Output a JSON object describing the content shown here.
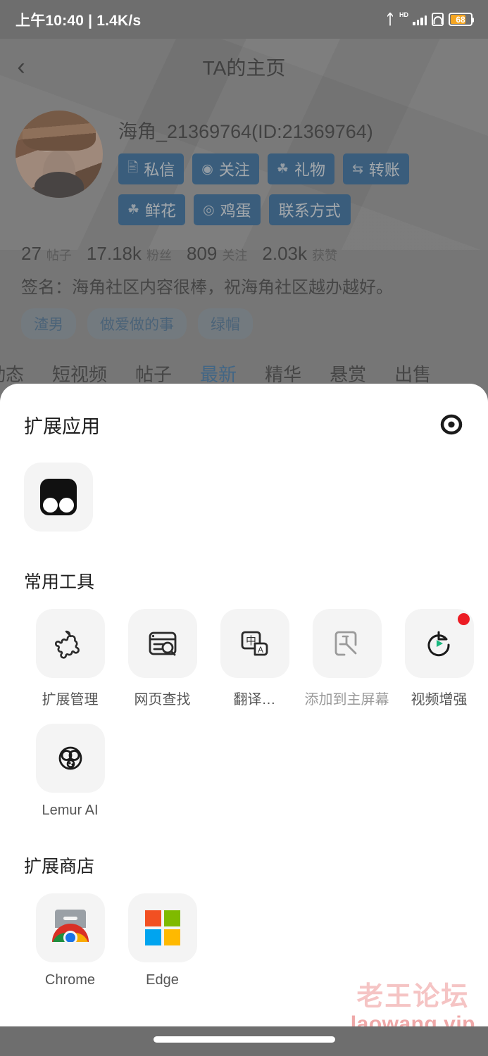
{
  "status_bar": {
    "time_text": "上午10:40 | 1.4K/s",
    "bluetooth_icon": "bluetooth-icon",
    "network_label": "HD",
    "battery_percent": "68"
  },
  "background_app": {
    "back_icon": "chevron-left-icon",
    "title": "TA的主页",
    "profile": {
      "username": "海角_21369764(ID:21369764)",
      "avatar": "user-avatar",
      "action_buttons_row1": [
        {
          "label": "私信",
          "icon": "message-icon"
        },
        {
          "label": "关注",
          "icon": "follow-icon"
        },
        {
          "label": "礼物",
          "icon": "gift-icon"
        },
        {
          "label": "转账",
          "icon": "transfer-icon"
        }
      ],
      "action_buttons_row2": [
        {
          "label": "鲜花",
          "icon": "flower-icon"
        },
        {
          "label": "鸡蛋",
          "icon": "egg-icon"
        },
        {
          "label": "联系方式",
          "icon": ""
        }
      ],
      "stats": [
        {
          "value": "27",
          "label": "帖子"
        },
        {
          "value": "17.18k",
          "label": "粉丝"
        },
        {
          "value": "809",
          "label": "关注"
        },
        {
          "value": "2.03k",
          "label": "获赞"
        }
      ],
      "signature": "签名：海角社区内容很棒，祝海角社区越办越好。",
      "tags": [
        "渣男",
        "做爱做的事",
        "绿帽"
      ]
    },
    "tabs": [
      {
        "label": "动态",
        "active": false
      },
      {
        "label": "短视频",
        "active": false
      },
      {
        "label": "帖子",
        "active": false
      },
      {
        "label": "最新",
        "active": true
      },
      {
        "label": "精华",
        "active": false
      },
      {
        "label": "悬赏",
        "active": false
      },
      {
        "label": "出售",
        "active": false
      }
    ],
    "active_tab_color": "#2f6fa8"
  },
  "sheet": {
    "title": "扩展应用",
    "header_action_icon": "target-record-icon",
    "pinned_extensions": [
      {
        "name": "",
        "icon": "extension-dual-circle-icon"
      }
    ],
    "sections": [
      {
        "title": "常用工具",
        "items": [
          {
            "label": "扩展管理",
            "icon": "puzzle-piece-icon",
            "disabled": false,
            "badge": false
          },
          {
            "label": "网页查找",
            "icon": "page-search-icon",
            "disabled": false,
            "badge": false
          },
          {
            "label": "翻译…",
            "icon": "translate-icon",
            "disabled": false,
            "badge": false
          },
          {
            "label": "添加到主屏幕",
            "icon": "add-to-homescreen-icon",
            "disabled": true,
            "badge": false
          },
          {
            "label": "视频增强",
            "icon": "video-enhance-icon",
            "disabled": false,
            "badge": true
          },
          {
            "label": "Lemur AI",
            "icon": "lemur-face-icon",
            "disabled": false,
            "badge": false
          }
        ]
      },
      {
        "title": "扩展商店",
        "items": [
          {
            "label": "Chrome",
            "icon": "chrome-webstore-icon",
            "disabled": false,
            "badge": false
          },
          {
            "label": "Edge",
            "icon": "microsoft-edge-addons-icon",
            "disabled": false,
            "badge": false
          }
        ]
      }
    ],
    "badge_color": "#ec1c24"
  },
  "watermark": {
    "line1": "老王论坛",
    "line2": "laowang.vip"
  },
  "nav_bar": {
    "home_indicator": "home-indicator"
  }
}
